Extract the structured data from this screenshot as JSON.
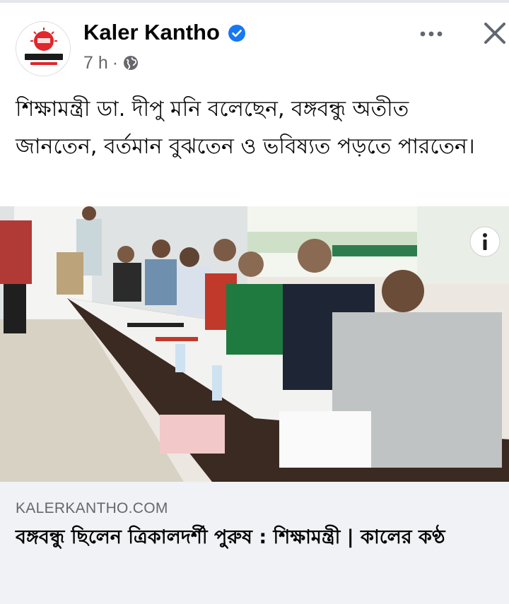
{
  "post": {
    "page_name": "Kaler Kantho",
    "time": "7 h",
    "separator": "·",
    "body_text": "শিক্ষামন্ত্রী ডা. দীপু মনি বলেছেন, বঙ্গবন্ধু অতীত জানতেন, বর্তমান বুঝতেন ও ভবিষ্যত পড়তে পারতেন।"
  },
  "icons": {
    "verified": "verified-badge-icon",
    "audience": "globe-icon",
    "more": "more-options-icon",
    "close": "close-icon",
    "info": "info-icon"
  },
  "link_preview": {
    "domain": "KALERKANTHO.COM",
    "title": "বঙ্গবন্ধু ছিলেন ত্রিকালদর্শী পুরুষ : শিক্ষামন্ত্রী | কালের কণ্ঠ"
  },
  "colors": {
    "verified_blue": "#1877f2",
    "meta_gray": "#65676b",
    "link_bg": "#f0f2f5",
    "logo_red": "#e1262c"
  }
}
